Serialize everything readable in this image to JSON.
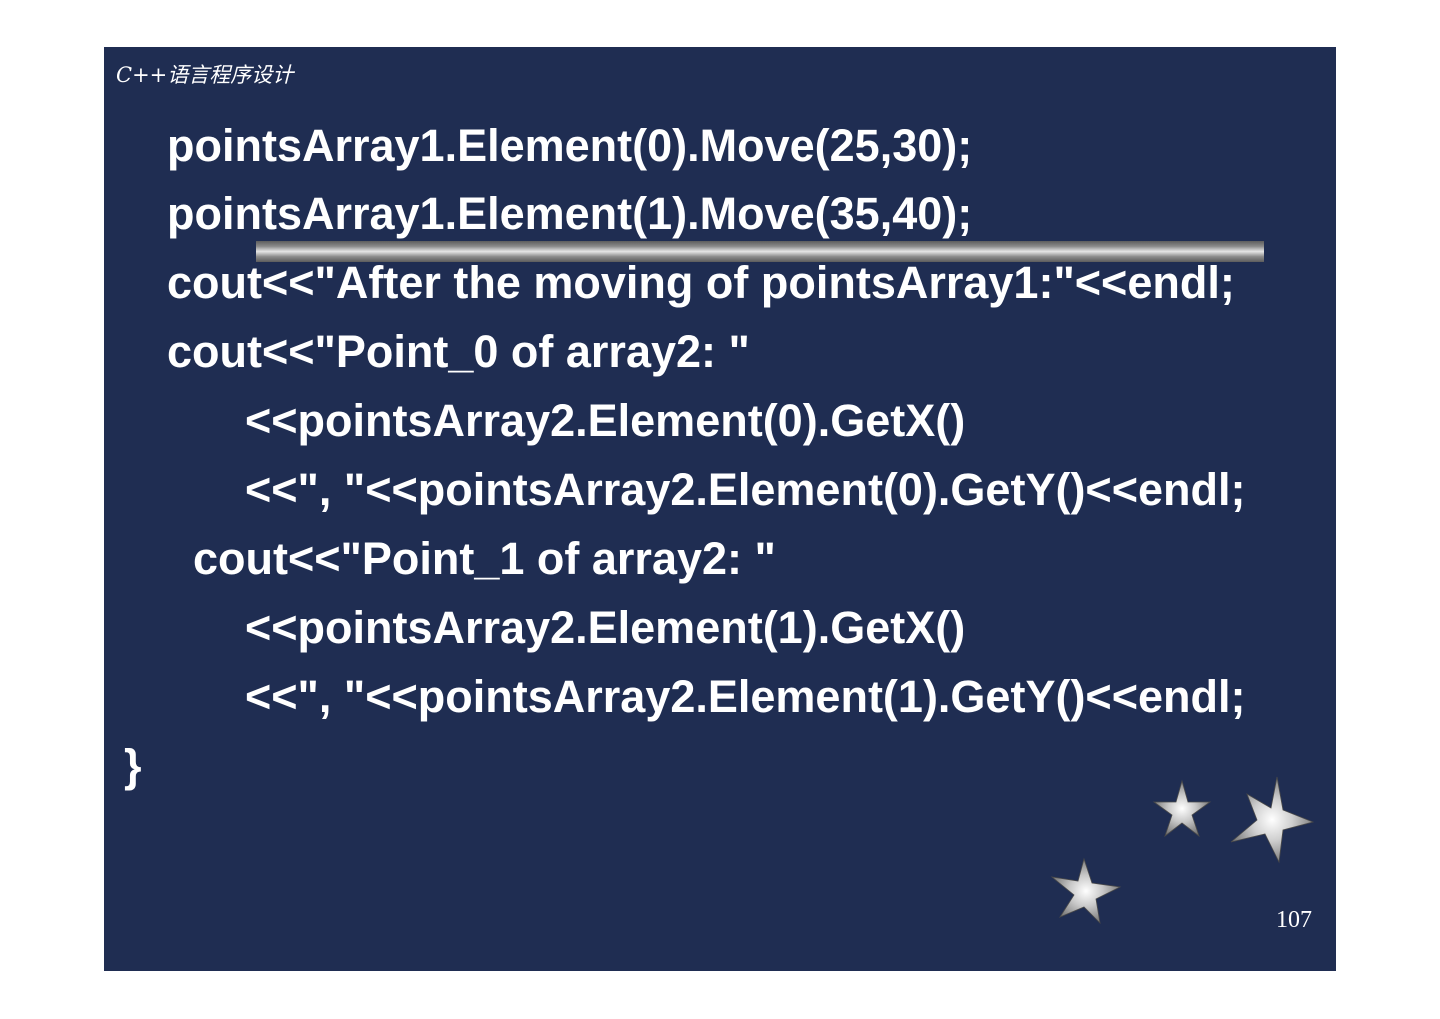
{
  "header": {
    "title": "C++语言程序设计"
  },
  "code": {
    "lines": [
      "pointsArray1.Element(0).Move(25,30);",
      "pointsArray1.Element(1).Move(35,40);",
      "cout<<\"After the moving of pointsArray1:\"<<endl;",
      "cout<<\"Point_0 of array2: \"",
      "<<pointsArray2.Element(0).GetX()",
      "<<\", \"<<pointsArray2.Element(0).GetY()<<endl;",
      "cout<<\"Point_1 of array2: \"",
      "<<pointsArray2.Element(1).GetX()",
      "<<\", \"<<pointsArray2.Element(1).GetY()<<endl;",
      "}"
    ]
  },
  "footer": {
    "page_number": "107"
  },
  "decorations": {
    "icons": [
      "star-icon",
      "star-icon",
      "star-icon"
    ]
  },
  "colors": {
    "background": "#1f2d52",
    "text": "#ffffff"
  }
}
